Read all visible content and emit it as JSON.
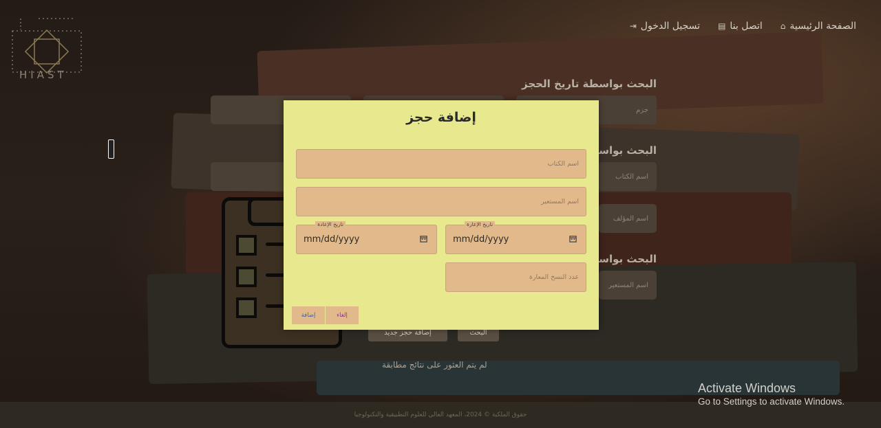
{
  "header": {
    "logo_text": "HIAST",
    "nav": [
      {
        "label": "تسجيل الدخول",
        "icon": "login-icon"
      },
      {
        "label": "اتصل بنا",
        "icon": "contact-card-icon"
      },
      {
        "label": "الصفحة الرئيسية",
        "icon": "home-icon"
      }
    ]
  },
  "background": {
    "sections": [
      {
        "title": "البحث بواسطة تاريخ الحجز",
        "field_placeholder": "جزم"
      },
      {
        "title": "البحث بواسطة",
        "field_placeholders": [
          "اسم الكتاب",
          "اسم المؤلف"
        ]
      },
      {
        "title": "البحث بواسطة",
        "field_placeholder": "اسم المستعير"
      }
    ],
    "buttons": [
      "إضافة حجز جديد",
      "البحث"
    ],
    "no_results": "لم يتم العثور على نتائج مطابقة"
  },
  "footer": {
    "text": "حقوق الملكية © 2024، المعهد العالي للعلوم التطبيقية والتكنولوجيا"
  },
  "modal": {
    "title": "إضافة حجز",
    "book_name_placeholder": "اسم الكتاب",
    "borrower_placeholder": "اسم المستعير",
    "return_date_label": "تاريخ الإعادة",
    "return_date_value": "mm/dd/yyyy",
    "loan_date_label": "تاريخ الإعارة",
    "loan_date_value": "mm/dd/yyyy",
    "copies_placeholder": "عدد النسخ المعارة",
    "add_button": "إضافة",
    "cancel_button": "إلغاء"
  },
  "os_watermark": {
    "title": "Activate Windows",
    "subtitle": "Go to Settings to activate Windows."
  }
}
